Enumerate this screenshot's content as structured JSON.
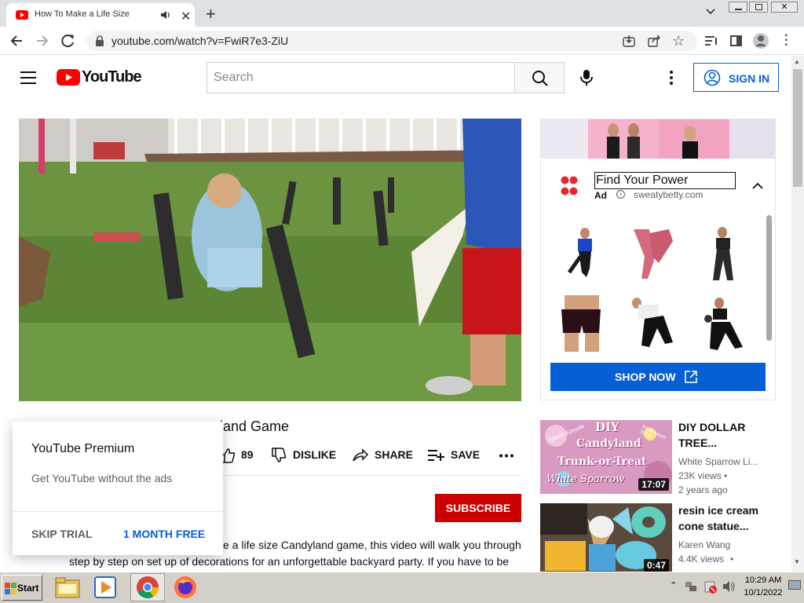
{
  "browser": {
    "tab_title": "How To Make a Life Size Candy",
    "url": "youtube.com/watch?v=FwiR7e3-ZiU"
  },
  "youtube": {
    "logo_text": "YouTube",
    "search_placeholder": "Search",
    "sign_in_label": "SIGN IN"
  },
  "video": {
    "title_visible": "land Game",
    "likes": "89",
    "dislike_label": "DISLIKE",
    "share_label": "SHARE",
    "save_label": "SAVE",
    "subscribe_label": "SUBSCRIBE",
    "description_line1": "e a life size Candyland game, this video will walk you through",
    "description_line2": "step by step on set up of decorations for an unforgettable backyard party. If you have to be"
  },
  "ad": {
    "headline": "Find Your Power",
    "ad_badge": "Ad",
    "domain": "sweatybetty.com",
    "cta_label": "SHOP NOW"
  },
  "suggestions": [
    {
      "title_line1": "DIY DOLLAR",
      "title_line2": "TREE...",
      "channel": "White Sparrow Li...",
      "views": "23K views",
      "age": "2 years ago",
      "duration": "17:07",
      "thumb_text1": "DIY",
      "thumb_text2": "Candyland",
      "thumb_text3": "Trunk-or-Treat",
      "thumb_text4": "White Sparrow",
      "thumb_text5": "Special Episode",
      "thumb_text6": "Halloween 2019"
    },
    {
      "title_line1": "resin ice cream",
      "title_line2": "cone statue...",
      "channel": "Karen Wang",
      "views": "4.4K views",
      "duration": "0:47"
    }
  ],
  "premium_popup": {
    "title": "YouTube Premium",
    "subtitle": "Get YouTube without the ads",
    "skip_label": "SKIP TRIAL",
    "accept_label": "1 MONTH FREE"
  },
  "taskbar": {
    "start_label": "Start",
    "time": "10:29 AM",
    "date": "10/1/2022"
  },
  "colors": {
    "youtube_red": "#ff0000",
    "subscribe_red": "#cc0000",
    "link_blue": "#065fd4",
    "ad_brand_red": "#e8262b"
  }
}
